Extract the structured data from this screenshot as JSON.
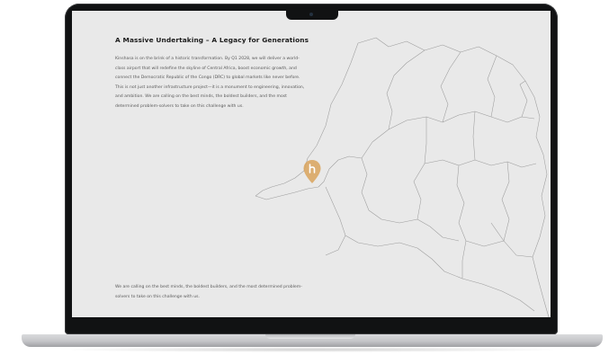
{
  "page": {
    "headline": "A Massive Undertaking – A Legacy for Generations",
    "intro": "Kinshasa is on the brink of a historic transformation. By Q1 2028, we will deliver a world-class airport that will redefine the skyline of Central Africa, boost economic growth, and connect the Democratic Republic of the Congo (DRC) to global markets like never before. This is not just another infrastructure project—it is a monument to engineering, innovation, and ambition. We are calling on the best minds, the boldest builders, and the most determined problem-solvers to take on this challenge with us.",
    "footer": "We are calling on the best minds, the boldest builders, and the most determined problem-solvers to take on this challenge with us."
  },
  "map": {
    "border_color": "#9d9d9d",
    "background_color": "#e9e9e9"
  },
  "marker": {
    "icon": "location-pin-icon",
    "color": "#d9a35c"
  }
}
